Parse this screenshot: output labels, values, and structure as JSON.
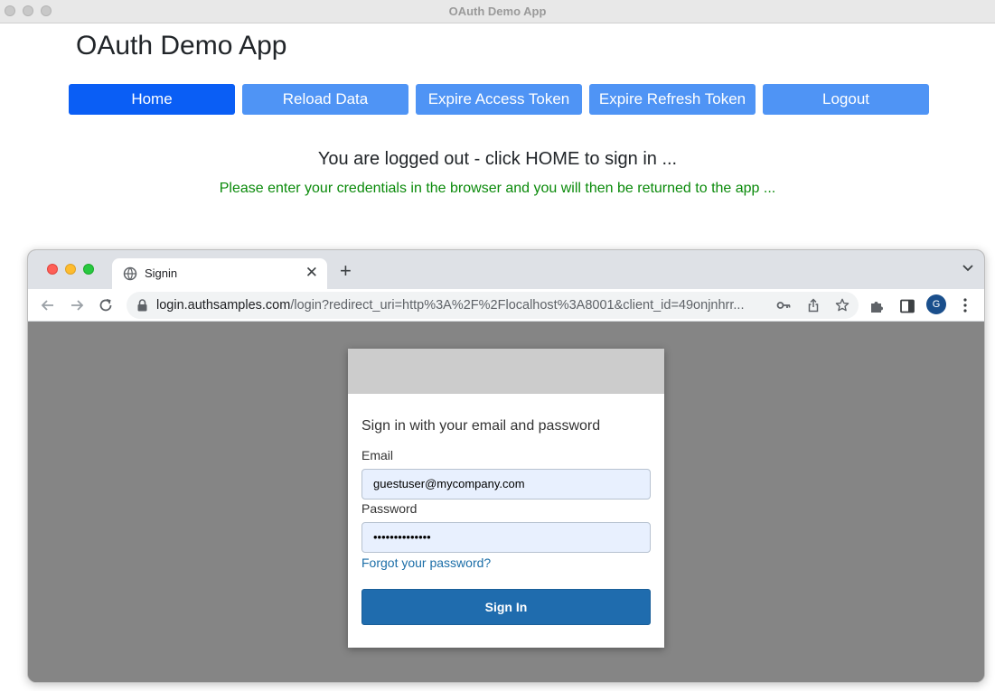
{
  "app_window": {
    "title": "OAuth Demo App"
  },
  "app": {
    "heading": "OAuth Demo App",
    "nav": [
      {
        "label": "Home",
        "active": true
      },
      {
        "label": "Reload Data"
      },
      {
        "label": "Expire Access Token"
      },
      {
        "label": "Expire Refresh Token"
      },
      {
        "label": "Logout"
      }
    ],
    "status_main": "You are logged out - click HOME to sign in ...",
    "status_sub": "Please enter your credentials in the browser and you will then be returned to the app ..."
  },
  "browser": {
    "tab": {
      "title": "Signin",
      "icon": "globe-icon"
    },
    "url_host": "login.authsamples.com",
    "url_path": "/login?redirect_uri=http%3A%2F%2Flocalhost%3A8001&client_id=49onjnhrr...",
    "profile_initial": "G"
  },
  "signin": {
    "heading": "Sign in with your email and password",
    "email_label": "Email",
    "email_value": "guestuser@mycompany.com",
    "password_label": "Password",
    "password_value": "••••••••••••••",
    "forgot_link": "Forgot your password?",
    "submit_label": "Sign In"
  },
  "colors": {
    "nav_active": "#0a5ef5",
    "nav_button": "#4f94f5",
    "status_sub": "#0a8a0a",
    "signin_button": "#1f6cae",
    "link": "#1b6ea8"
  }
}
